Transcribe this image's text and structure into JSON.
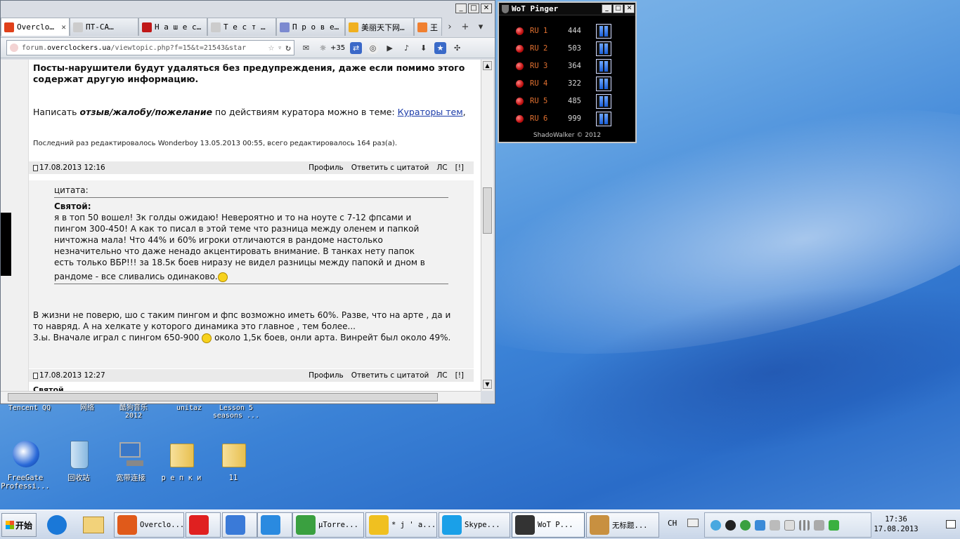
{
  "browser": {
    "window_buttons": {
      "minimize": "_",
      "maximize": "□",
      "close": "✕"
    },
    "tabs": [
      {
        "label": "Overclo…",
        "color": "#e0401a",
        "close": "✕",
        "active": true
      },
      {
        "label": "ПТ-СА…",
        "color": "#cccccc",
        "close": "",
        "active": false
      },
      {
        "label": "Н а ш е с…",
        "color": "#c01818",
        "close": "",
        "active": false
      },
      {
        "label": "Т е с т  …",
        "color": "#cccccc",
        "close": "",
        "active": false
      },
      {
        "label": "П р о в е…",
        "color": "#7c8ad0",
        "close": "",
        "active": false
      },
      {
        "label": "美丽天下网…",
        "color": "#f0b020",
        "close": "",
        "active": false
      },
      {
        "label": "王",
        "color": "#f08030",
        "close": "",
        "active": false
      }
    ],
    "tab_controls": {
      "next": "›",
      "new_tab": "+",
      "menu": "▾"
    },
    "url": {
      "host": "overclockers.ua",
      "prefix": "forum.",
      "path": "/viewtopic.php?f=15&t=21543&star"
    },
    "toolbar": {
      "star": "☆",
      "dropdown": "▿",
      "reload": "↻",
      "badge_count": "+35"
    },
    "page": {
      "rules_line1": "Посты-нарушители будут удаляться без предупреждения, даже если помимо этого",
      "rules_line2": "содержат другую информацию.",
      "feedback_prefix": "Написать ",
      "feedback_bold": "отзыв/жалобу/пожелание",
      "feedback_mid": " по действиям куратора можно в теме: ",
      "feedback_link": "Кураторы тем",
      "feedback_end": ",",
      "edited_note": "Последний раз редактировалось Wonderboy 13.05.2013 00:55, всего редактировалось 164 раз(а).",
      "post1": {
        "date": "17.08.2013 12:16",
        "profile": "Профиль",
        "reply_quote": "Ответить с цитатой",
        "pm": "ЛС",
        "report": "[!]",
        "quote_label": "цитата:",
        "quote_author": "Святой:",
        "quote_lines": [
          "я в топ 50 вошел! 3к голды ожидаю! Невероятно и то на ноуте с 7-12 фпсами и",
          "пингом 300-450! А как то писал в этой теме что разница между оленем и папкой",
          "ничтожна мала! Что 44% и 60% игроки отличаются в рандоме настолько",
          "незначительно что даже ненадо акцентировать внимание. В танках нету папок",
          "есть только ВБР!!! за 18.5к боев ниразу не видел разницы между папокй и дном в"
        ],
        "quote_last": "рандоме - все сливались одинаково.",
        "reply_line1": "В жизни не поверю, шо с таким пингом и фпс возможно иметь 60%. Разве, что на арте , да и",
        "reply_line2": "то навряд. А на хелкате у которого динамика это главное , тем более...",
        "reply_line3a": "З.ы. Вначале играл с пингом 650-900 ",
        "reply_line3b": " около 1,5к боев, онли арта. Винрейт был около 49%."
      },
      "post2": {
        "date": "17.08.2013 12:27",
        "profile": "Профиль",
        "reply_quote": "Ответить с цитатой",
        "pm": "ЛС",
        "report": "[!]",
        "author_partial": "Святой"
      }
    }
  },
  "pinger": {
    "title": "WoT Pinger",
    "servers": [
      {
        "name": "RU 1",
        "ping": "444"
      },
      {
        "name": "RU 2",
        "ping": "503"
      },
      {
        "name": "RU 3",
        "ping": "364"
      },
      {
        "name": "RU 4",
        "ping": "322"
      },
      {
        "name": "RU 5",
        "ping": "485"
      },
      {
        "name": "RU 6",
        "ping": "999"
      }
    ],
    "footer": "ShadoWalker © 2012"
  },
  "desktop": {
    "top_labels": [
      {
        "text": "Tencent QQ"
      },
      {
        "text": "网络"
      },
      {
        "text": "酷狗音乐\n2012"
      },
      {
        "text": "unitaz"
      },
      {
        "text": "Lesson 5\nseasons ..."
      }
    ],
    "icons": [
      {
        "label": "FreeGate\nProfessi...",
        "kind": "freegate"
      },
      {
        "label": "回收站",
        "kind": "recycle"
      },
      {
        "label": "宽带连接",
        "kind": "network"
      },
      {
        "label": "р е п к и",
        "kind": "folder"
      },
      {
        "label": "11",
        "kind": "folder"
      }
    ]
  },
  "taskbar": {
    "start_label": "开始",
    "buttons": [
      {
        "label": "Overclo...",
        "color": "#e05a1a"
      },
      {
        "label": "",
        "color": "#e02020"
      },
      {
        "label": "",
        "color": "#3a7ad8"
      },
      {
        "label": "",
        "color": "#2a8ae0"
      },
      {
        "label": "µTorre...",
        "color": "#3aa040"
      },
      {
        "label": "* j ' a...",
        "color": "#f0c020"
      },
      {
        "label": "Skype...",
        "color": "#1aa0e8"
      },
      {
        "label": "WoT P...",
        "color": "#333333"
      },
      {
        "label": "无标题...",
        "color": "#c89040"
      }
    ],
    "lang": "CH",
    "time": "17:36",
    "date": "17.08.2013"
  }
}
